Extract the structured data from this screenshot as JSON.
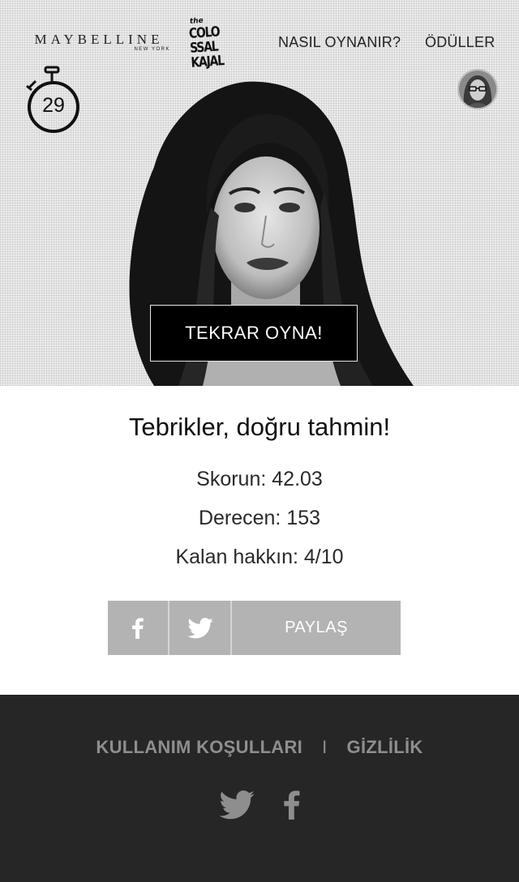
{
  "header": {
    "brand_main": "MAYBELLINE",
    "brand_sub": "NEW YORK",
    "campaign_logo": {
      "the": "the",
      "lines": [
        "COLO",
        "SSAL",
        "KAJAL"
      ]
    },
    "nav": {
      "how_to_play": "NASIL OYNANIR?",
      "prizes": "ÖDÜLLER"
    },
    "timer": "29"
  },
  "hero": {
    "replay_button": "TEKRAR OYNA!"
  },
  "result": {
    "title": "Tebrikler, doğru tahmin!",
    "score": "Skorun: 42.03",
    "rank": "Derecen: 153",
    "remaining": "Kalan hakkın: 4/10"
  },
  "share": {
    "label": "PAYLAŞ",
    "icons": [
      "facebook-icon",
      "twitter-icon"
    ]
  },
  "footer": {
    "terms": "KULLANIM KOŞULLARI",
    "separator": "I",
    "privacy": "GİZLİLİK",
    "social_icons": [
      "twitter-icon",
      "facebook-icon"
    ]
  },
  "colors": {
    "hero_bg": "#ececec",
    "button_bg": "#000000",
    "share_bar": "#b3b3b3",
    "footer_bg": "#262626",
    "footer_text": "#8e8e8e"
  }
}
